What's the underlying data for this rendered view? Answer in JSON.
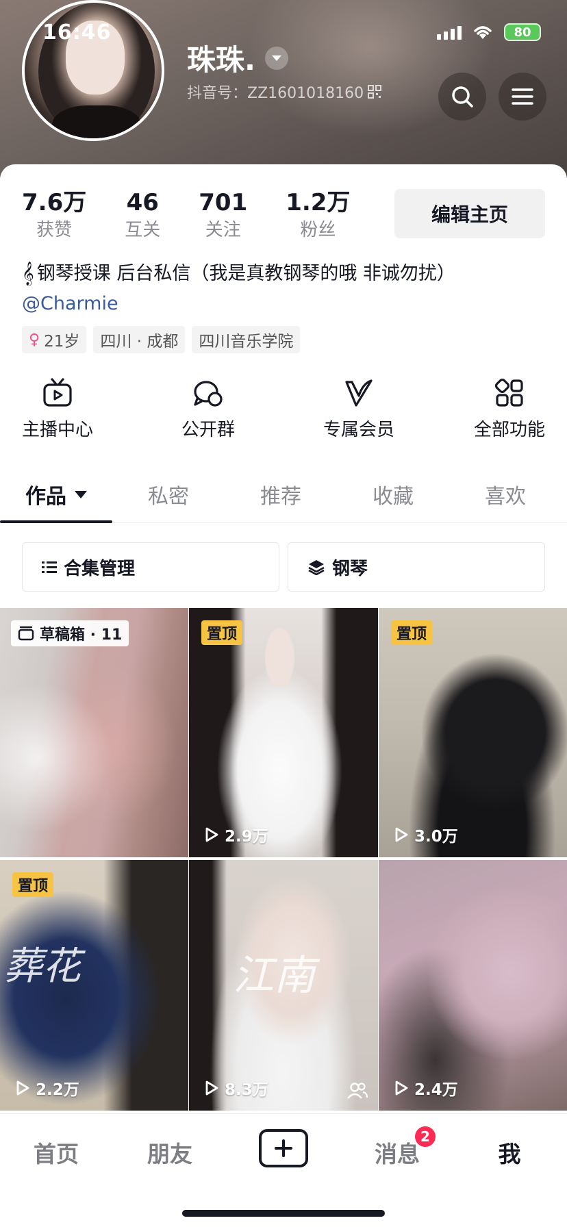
{
  "status_bar": {
    "time": "16:46",
    "battery": "80"
  },
  "profile": {
    "name": "珠珠.",
    "douyin_id": "抖音号：ZZ1601018160",
    "stats": [
      {
        "value": "7.6万",
        "label": "获赞"
      },
      {
        "value": "46",
        "label": "互关"
      },
      {
        "value": "701",
        "label": "关注"
      },
      {
        "value": "1.2万",
        "label": "粉丝"
      }
    ],
    "edit_label": "编辑主页",
    "bio_icon": "𝄞",
    "bio": "钢琴授课  后台私信（我是真教钢琴的哦 非诚勿扰）",
    "mention": "@Charmie",
    "tags": [
      {
        "icon": "♀",
        "text": "21岁"
      },
      {
        "text": "四川 · 成都"
      },
      {
        "text": "四川音乐学院"
      }
    ]
  },
  "quick_actions": [
    {
      "label": "主播中心",
      "icon": "tv-play-icon"
    },
    {
      "label": "公开群",
      "icon": "chat-group-icon"
    },
    {
      "label": "专属会员",
      "icon": "v-member-icon"
    },
    {
      "label": "全部功能",
      "icon": "grid-apps-icon"
    }
  ],
  "tabs": [
    "作品",
    "私密",
    "推荐",
    "收藏",
    "喜欢"
  ],
  "collections": [
    {
      "label": "合集管理",
      "icon": "list-icon"
    },
    {
      "label": "钢琴",
      "icon": "layers-icon"
    }
  ],
  "videos": [
    {
      "badge": "草稿箱 · 11",
      "type": "draft",
      "plays": ""
    },
    {
      "badge": "置顶",
      "type": "pinned",
      "plays": "2.9万"
    },
    {
      "badge": "置顶",
      "type": "pinned",
      "plays": "3.0万"
    },
    {
      "badge": "置顶",
      "type": "pinned",
      "plays": "2.2万",
      "overlay": "葬花"
    },
    {
      "badge": "",
      "type": "normal",
      "plays": "8.3万",
      "overlay": "江南",
      "friends": true
    },
    {
      "badge": "",
      "type": "normal",
      "plays": "2.4万"
    }
  ],
  "bottom_nav": {
    "items": [
      "首页",
      "朋友",
      "消息",
      "我"
    ],
    "message_badge": "2",
    "active": "我"
  },
  "colors": {
    "accent": "#fe2c55",
    "pin_badge": "#f6c342",
    "link": "#3a5a9a"
  }
}
